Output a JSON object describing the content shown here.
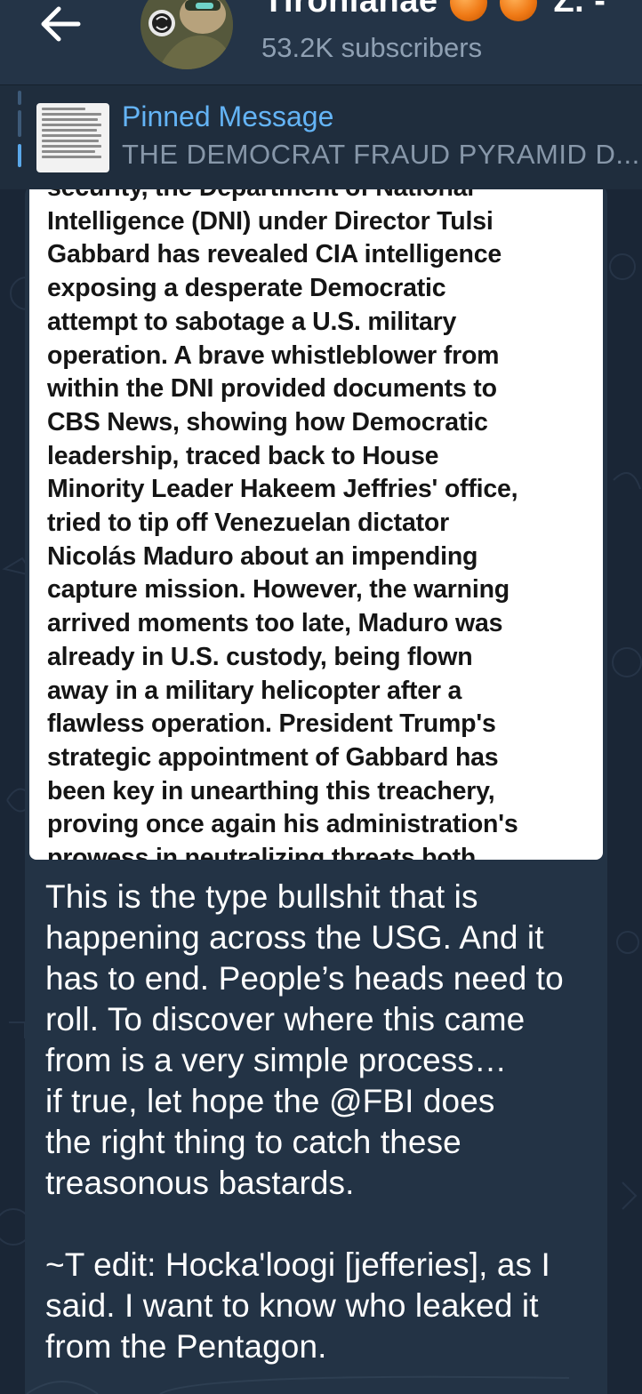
{
  "header": {
    "title": "Tironianae",
    "title_suffix": "Z. -",
    "subscribers": "53.2K subscribers",
    "back_icon": "arrow-left-icon",
    "title_emoji": "orange-fruit-emoji"
  },
  "pinned": {
    "label": "Pinned Message",
    "preview": "THE DEMOCRAT FRAUD PYRAMID  D...",
    "icon": "pin-indicator"
  },
  "message": {
    "photo_text": "security, the Department of National\nIntelligence (DNI) under Director Tulsi\nGabbard has revealed CIA intelligence\nexposing a desperate Democratic\nattempt to sabotage a U.S. military\noperation. A brave whistleblower from\nwithin the DNI provided documents to\nCBS News, showing how Democratic\nleadership, traced back to House\nMinority Leader Hakeem Jeffries' office,\ntried to tip off Venezuelan dictator\nNicolás Maduro about an impending\ncapture mission. However, the warning\narrived moments too late, Maduro was\nalready in U.S. custody, being flown\naway in a military helicopter after a\nflawless operation. President Trump's\nstrategic appointment of Gabbard has\nbeen key in unearthing this treachery,\nproving once again his administration's\nprowess in neutralizing threats both",
    "caption": "This is the type bullshit that is\nhappening across the USG. And it\nhas to end. People’s heads need to\nroll. To discover where this came\nfrom is a very simple process…\nif true, let hope the @FBI does\nthe right thing to catch these\ntreasonous bastards.\n\n~T edit: Hocka'loogi [jefferies], as I\nsaid. I want to know who leaked it\nfrom the Pentagon."
  },
  "colors": {
    "background": "#1a2636",
    "header": "#243447",
    "bubble": "#233345",
    "accent": "#64b4f6"
  }
}
